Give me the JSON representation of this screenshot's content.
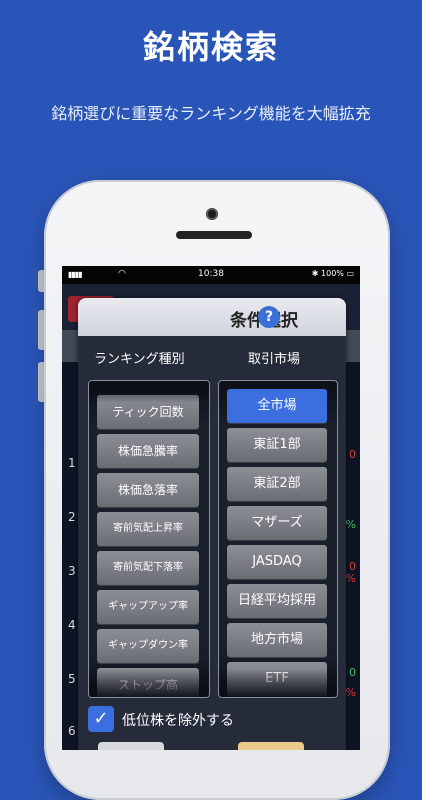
{
  "hero": {
    "title": "銘柄検索",
    "subtitle": "銘柄選びに重要なランキング機能を大幅拡充"
  },
  "status_bar": {
    "signal": "▮▮▮▮",
    "wifi": "wifi-icon",
    "time": "10:38",
    "battery": "✱ 100% ▭"
  },
  "background_list": {
    "row_numbers": [
      "1",
      "2",
      "3",
      "4",
      "5",
      "6"
    ],
    "right_chars": [
      "0",
      "%",
      "0",
      "%",
      "0",
      "%"
    ]
  },
  "modal": {
    "title": "条件選択",
    "help": "?",
    "left_column_label": "ランキング種別",
    "right_column_label": "取引市場",
    "ranking_types": [
      "ティック回数",
      "株価急騰率",
      "株価急落率",
      "寄前気配上昇率",
      "寄前気配下落率",
      "ギャップアップ率",
      "ギャップダウン率",
      "ストップ高"
    ],
    "markets": [
      "全市場",
      "東証1部",
      "東証2部",
      "マザーズ",
      "JASDAQ",
      "日経平均採用",
      "地方市場",
      "ETF"
    ],
    "selected_market": "全市場",
    "exclude_checkbox": {
      "label": "低位株を除外する",
      "checked": true
    }
  },
  "colors": {
    "background": "#2a55b8",
    "accent": "#3b6fe0",
    "item_gray": "#7c7f86",
    "modal_bg": "#262b3a"
  }
}
